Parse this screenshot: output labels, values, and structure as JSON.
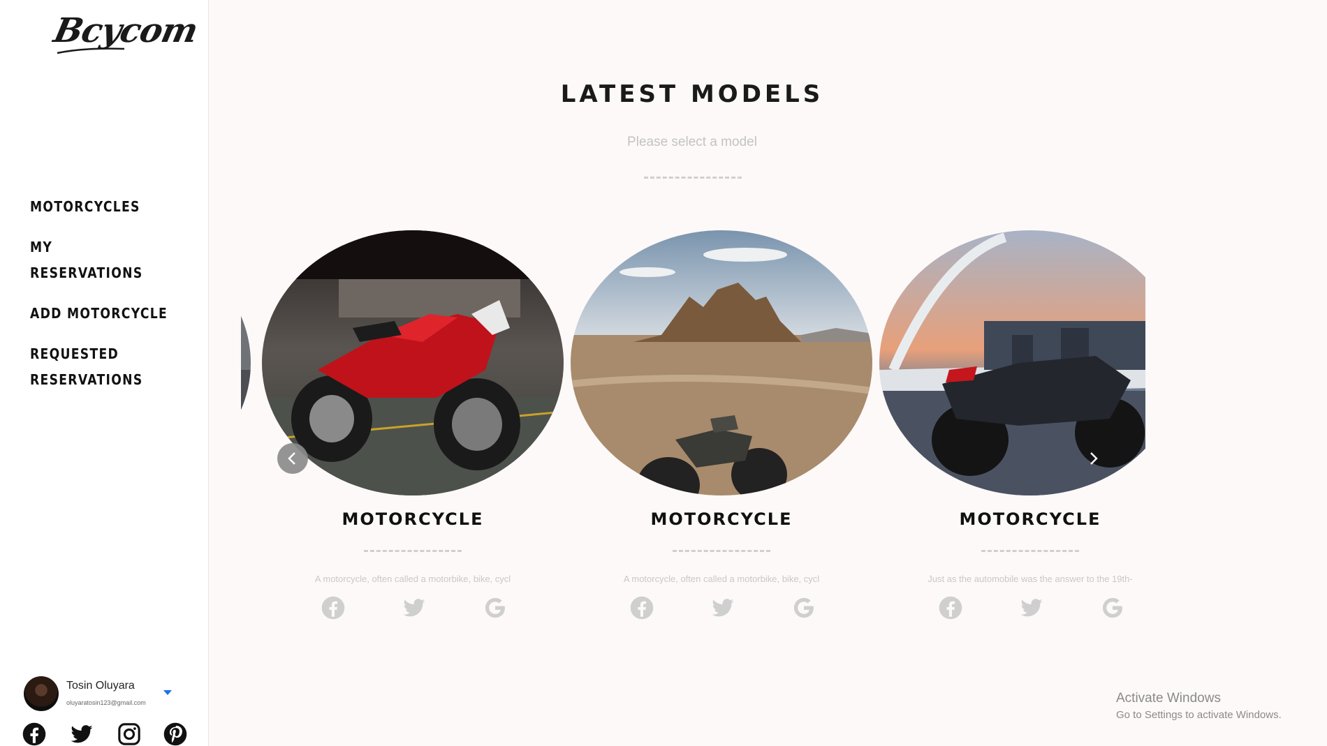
{
  "brand": {
    "logo_text": "Bcycom"
  },
  "nav": {
    "items": [
      {
        "label": "MOTORCYCLES"
      },
      {
        "label": "MY RESERVATIONS"
      },
      {
        "label": "ADD MOTORCYCLE"
      },
      {
        "label": "REQUESTED RESERVATIONS"
      }
    ]
  },
  "user": {
    "name": "Tosin Oluyara",
    "email": "oluyaratosin123@gmail.com"
  },
  "sidebar_socials": [
    "facebook-icon",
    "twitter-icon",
    "instagram-icon",
    "pinterest-icon"
  ],
  "main": {
    "title": "LATEST MODELS",
    "subtitle": "Please select a model"
  },
  "cards": [
    {
      "title": "MOTORCYCLE",
      "description": "A motorcycle, often called a motorbike, bike, cycl",
      "image": "red-sport-motorcycle-garage"
    },
    {
      "title": "MOTORCYCLE",
      "description": "A motorcycle, often called a motorbike, bike, cycl",
      "image": "scrambler-motorcycle-desert"
    },
    {
      "title": "MOTORCYCLE",
      "description": "Just as the automobile was the answer to the 19th-",
      "image": "black-sport-motorcycle-bridge-sunset"
    }
  ],
  "card_icons": [
    "facebook-icon",
    "twitter-icon",
    "google-icon"
  ],
  "watermark": {
    "line1": "Activate Windows",
    "line2": "Go to Settings to activate Windows."
  },
  "colors": {
    "background": "#fdf9f8",
    "sidebar": "#ffffff",
    "text": "#111111",
    "muted": "#c3c3c3",
    "accent": "#1a73e8"
  }
}
